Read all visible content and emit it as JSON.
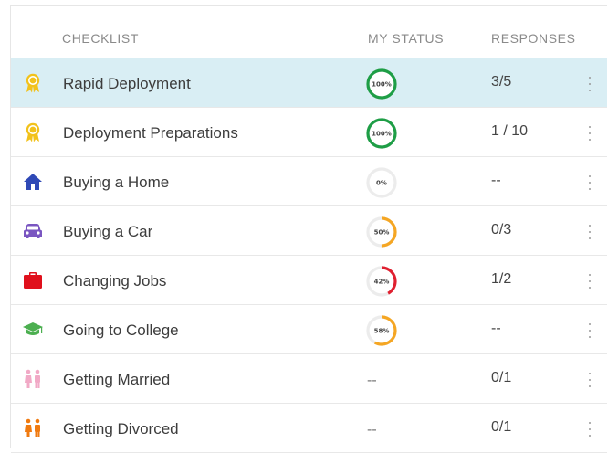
{
  "headers": {
    "checklist": "CHECKLIST",
    "status": "MY STATUS",
    "responses": "RESPONSES"
  },
  "colors": {
    "selected_row": "#d9eef4",
    "complete": "#1e9e46",
    "partial": "#f5a623",
    "low": "#e02030"
  },
  "rows": [
    {
      "name": "Rapid Deployment",
      "icon": "ribbon-award-icon",
      "icon_color": "#f2c21b",
      "status_label": "100%",
      "progress": 100,
      "ring_color": "#1e9e46",
      "responses": "3/5",
      "selected": true
    },
    {
      "name": "Deployment Preparations",
      "icon": "ribbon-award-icon",
      "icon_color": "#f2c21b",
      "status_label": "100%",
      "progress": 100,
      "ring_color": "#1e9e46",
      "responses": "1 / 10",
      "selected": false
    },
    {
      "name": "Buying a Home",
      "icon": "house-icon",
      "icon_color": "#2f49b6",
      "status_label": "0%",
      "progress": 0,
      "ring_color": "#e6e6e6",
      "responses": "--",
      "selected": false
    },
    {
      "name": "Buying a Car",
      "icon": "car-icon",
      "icon_color": "#7a56c1",
      "status_label": "50%",
      "progress": 50,
      "ring_color": "#f5a623",
      "responses": "0/3",
      "selected": false
    },
    {
      "name": "Changing Jobs",
      "icon": "briefcase-icon",
      "icon_color": "#e0101c",
      "status_label": "42%",
      "progress": 42,
      "ring_color": "#e02030",
      "responses": "1/2",
      "selected": false
    },
    {
      "name": "Going to College",
      "icon": "graduation-cap-icon",
      "icon_color": "#4caf50",
      "status_label": "58%",
      "progress": 58,
      "ring_color": "#f5a623",
      "responses": "--",
      "selected": false
    },
    {
      "name": "Getting Married",
      "icon": "couple-icon",
      "icon_color": "#f1a9c6",
      "status_label": "--",
      "progress": null,
      "ring_color": "",
      "responses": "0/1",
      "selected": false
    },
    {
      "name": "Getting Divorced",
      "icon": "couple-icon",
      "icon_color": "#f07a10",
      "status_label": "--",
      "progress": null,
      "ring_color": "",
      "responses": "0/1",
      "selected": false
    }
  ]
}
